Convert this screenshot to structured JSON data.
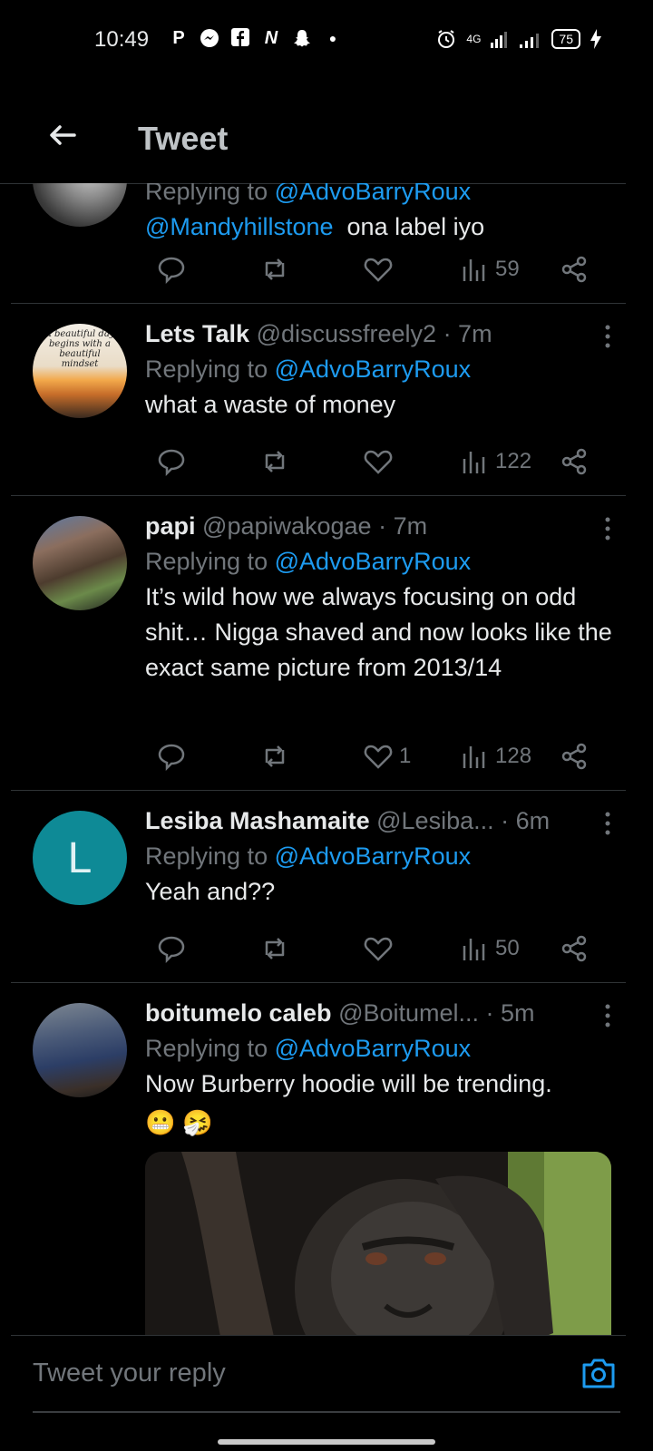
{
  "status": {
    "time": "10:49",
    "app_icons": [
      "P",
      "messenger-icon",
      "F",
      "N",
      "snapchat-icon"
    ],
    "network": "4G",
    "battery": "75"
  },
  "header": {
    "title": "Tweet"
  },
  "tweets": [
    {
      "reply_prefix": "Replying to",
      "reply_handle": "@AdvoBarryRoux",
      "mention": "@Mandyhillstone",
      "text": "ona label iyo",
      "views": "59"
    },
    {
      "name": "Lets Talk",
      "handle": "@discussfreely2",
      "time": "· 7m",
      "reply_prefix": "Replying to",
      "reply_handle": "@AdvoBarryRoux",
      "text": "what a waste of money",
      "views": "122",
      "avatar_text": "A beautiful day begins with a beautiful mindset"
    },
    {
      "name": "papi",
      "handle": "@papiwakogae",
      "time": "· 7m",
      "reply_prefix": "Replying to",
      "reply_handle": "@AdvoBarryRoux",
      "text": "It’s wild how we always focusing on odd shit… Nigga shaved and now looks like the exact same picture from 2013/14",
      "likes": "1",
      "views": "128"
    },
    {
      "name": "Lesiba Mashamaite",
      "handle": "@Lesiba...",
      "time": "· 6m",
      "reply_prefix": "Replying to",
      "reply_handle": "@AdvoBarryRoux",
      "text": "Yeah and??",
      "views": "50",
      "avatar_letter": "L"
    },
    {
      "name": "boitumelo caleb",
      "handle": "@Boitumel...",
      "time": "· 5m",
      "reply_prefix": "Replying to",
      "reply_handle": "@AdvoBarryRoux",
      "text": "Now Burberry hoodie will be trending.",
      "emoji": "😬 🤧"
    }
  ],
  "reply_box": {
    "placeholder": "Tweet your reply"
  },
  "colors": {
    "background": "#000000",
    "link": "#1d9bf0",
    "muted": "#71767b",
    "teal_avatar": "#0e8a96"
  }
}
